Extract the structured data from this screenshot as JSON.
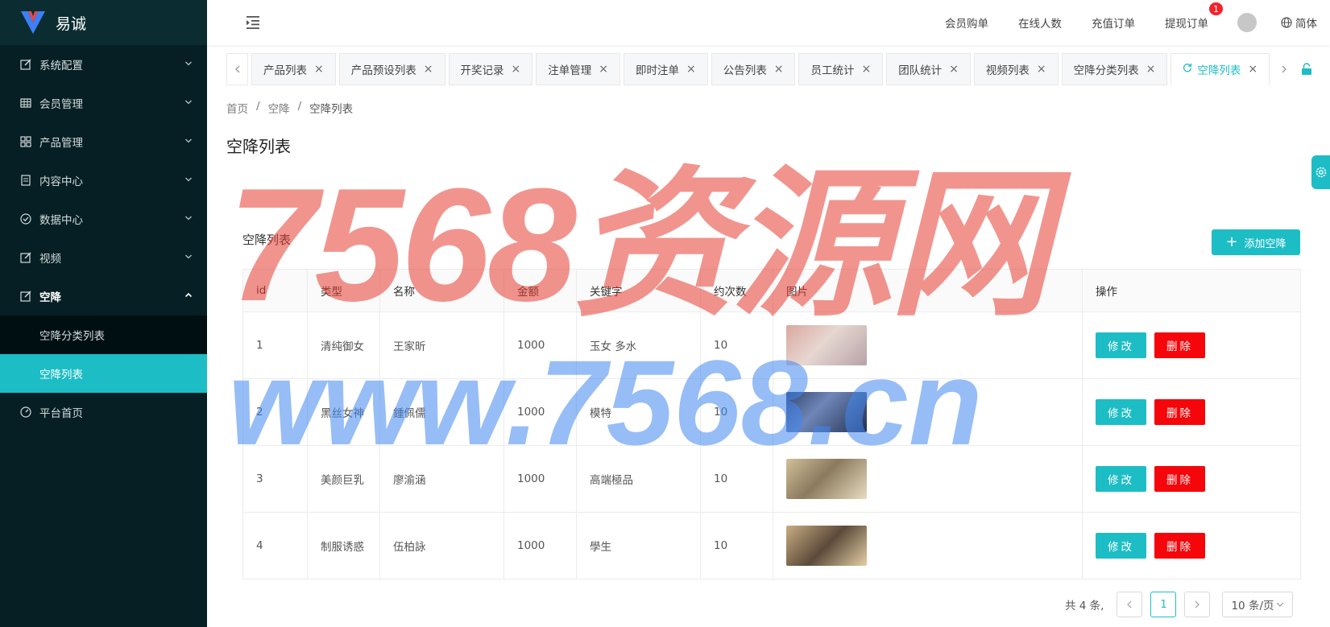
{
  "brand": {
    "name": "易诚"
  },
  "sidebar": {
    "items": [
      {
        "label": "系统配置",
        "icon": "edit-square-icon"
      },
      {
        "label": "会员管理",
        "icon": "table-icon"
      },
      {
        "label": "产品管理",
        "icon": "appstore-icon"
      },
      {
        "label": "内容中心",
        "icon": "document-icon"
      },
      {
        "label": "数据中心",
        "icon": "check-circle-icon"
      },
      {
        "label": "视频",
        "icon": "edit-square-icon"
      },
      {
        "label": "空降",
        "icon": "edit-square-icon",
        "open": true,
        "children": [
          {
            "label": "空降分类列表"
          },
          {
            "label": "空降列表",
            "active": true
          }
        ]
      },
      {
        "label": "平台首页",
        "icon": "dashboard-icon"
      }
    ]
  },
  "topbar": {
    "links": [
      "会员购单",
      "在线人数",
      "充值订单",
      "提现订单"
    ],
    "withdraw_badge": "1",
    "lang": "简体"
  },
  "tabs": [
    {
      "label": "产品列表"
    },
    {
      "label": "产品预设列表"
    },
    {
      "label": "开奖记录"
    },
    {
      "label": "注单管理"
    },
    {
      "label": "即时注单"
    },
    {
      "label": "公告列表"
    },
    {
      "label": "员工统计"
    },
    {
      "label": "团队统计"
    },
    {
      "label": "视频列表"
    },
    {
      "label": "空降分类列表"
    },
    {
      "label": "空降列表",
      "active": true
    }
  ],
  "breadcrumb": [
    "首页",
    "空降",
    "空降列表"
  ],
  "page_title": "空降列表",
  "card": {
    "title": "空降列表",
    "add_button": "添加空降"
  },
  "table": {
    "columns": [
      "id",
      "类型",
      "名称",
      "金额",
      "关键字",
      "约次数",
      "图片",
      "操作"
    ],
    "rows": [
      {
        "id": "1",
        "type": "清纯御女",
        "name": "王家昕",
        "amount": "1000",
        "keywords": "玉女 多水",
        "count": "10"
      },
      {
        "id": "2",
        "type": "黑丝女神",
        "name": "鍾佩儒",
        "amount": "1000",
        "keywords": "模特",
        "count": "10"
      },
      {
        "id": "3",
        "type": "美颜巨乳",
        "name": "廖渝涵",
        "amount": "1000",
        "keywords": "高端極品",
        "count": "10"
      },
      {
        "id": "4",
        "type": "制服诱惑",
        "name": "伍柏詠",
        "amount": "1000",
        "keywords": "學生",
        "count": "10"
      }
    ],
    "edit_label": "修改",
    "delete_label": "删除"
  },
  "pagination": {
    "total": "共 4 条,",
    "current": "1",
    "page_size": "10 条/页"
  },
  "watermark": {
    "line1": "7568资源网",
    "line2": "www.7568.cn"
  },
  "colors": {
    "accent": "#1dbdc5",
    "danger": "#f5060a",
    "sidebar": "#051f24"
  }
}
